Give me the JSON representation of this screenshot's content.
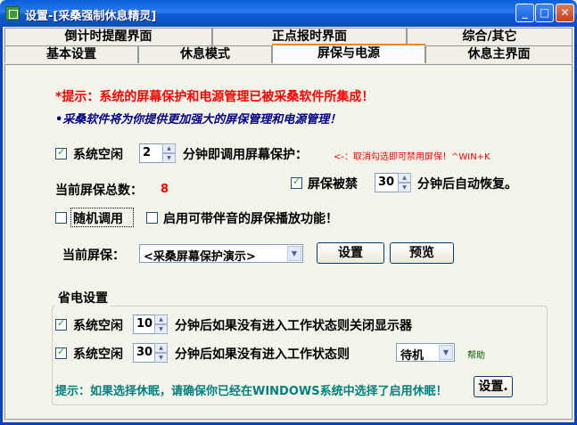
{
  "window": {
    "title": "设置-[采桑强制休息精灵]",
    "min_glyph": "_",
    "max_glyph": "□",
    "close_glyph": "✕"
  },
  "tabs": {
    "row_top": [
      "倒计时提醒界面",
      "正点报时界面",
      "综合/其它"
    ],
    "row_bottom": [
      "基本设置",
      "休息模式",
      "屏保与电源",
      "休息主界面"
    ],
    "active": "屏保与电源"
  },
  "notice": {
    "line1": "*提示：系统的屏幕保护和电源管理已被采桑软件所集成！",
    "line2": "•采桑软件将为你提供更加强大的屏保管理和电源管理！"
  },
  "screensaver": {
    "idle_label": "系统空闲",
    "idle_minutes": "2",
    "idle_suffix": "分钟即调用屏幕保护：",
    "idle_hint": "<-：取消勾选即可禁用屏保！^WIN+K",
    "count_label": "当前屏保总数：",
    "count_value": "8",
    "forbidden_label": "屏保被禁",
    "forbidden_minutes": "30",
    "forbidden_suffix": "分钟后自动恢复。",
    "random_label": "随机调用",
    "sound_label": "启用可带伴音的屏保播放功能！",
    "current_label": "当前屏保：",
    "current_value": "<采桑屏幕保护演示>",
    "settings_button": "设置",
    "preview_button": "预览"
  },
  "power": {
    "group_title": "省电设置",
    "monitor_label": "系统空闲",
    "monitor_minutes": "10",
    "monitor_suffix": "分钟后如果没有进入工作状态则关闭显示器",
    "state_label": "系统空闲",
    "state_minutes": "30",
    "state_suffix": "分钟后如果没有进入工作状态则",
    "state_value": "待机",
    "help_label": "帮助",
    "tip": "提示：如果选择休眠，请确保你已经在WINDOWS系统中选择了启用休眠！",
    "settings_button": "设置."
  }
}
